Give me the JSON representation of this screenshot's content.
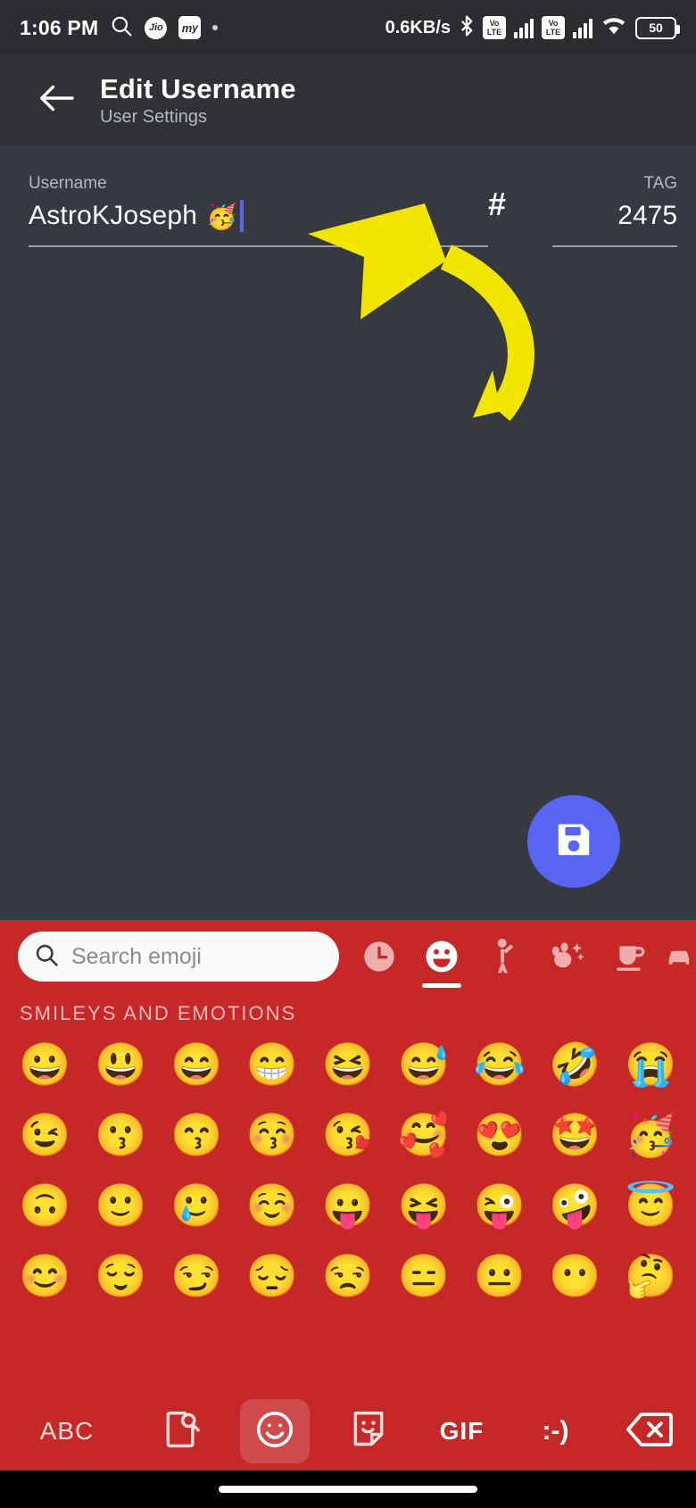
{
  "status_bar": {
    "time": "1:06 PM",
    "search_icon": "search-icon",
    "carrier_badges": [
      "Jio",
      "my"
    ],
    "dot_indicator": "•",
    "network_speed": "0.6KB/s",
    "bluetooth_icon": "bluetooth-icon",
    "volte_label_top": "Vo",
    "volte_label_bottom": "LTE",
    "sim_count": 2,
    "wifi_icon": "wifi-icon",
    "battery_percent": "50"
  },
  "app_bar": {
    "back_icon": "back-arrow-icon",
    "title": "Edit Username",
    "subtitle": "User Settings"
  },
  "form": {
    "username": {
      "label": "Username",
      "value": "AstroKJoseph",
      "emoji": "🥳",
      "caret_color": "#5865f2"
    },
    "separator": "#",
    "tag": {
      "label": "TAG",
      "value": "2475"
    }
  },
  "fab": {
    "name": "save-button",
    "icon": "floppy-disk-save-icon",
    "color": "#5865f2"
  },
  "annotations": {
    "arrow_color": "#f2e500",
    "arrow_top_name": "pointer-arrow-to-username-field",
    "arrow_bottom_name": "pointer-arrow-to-emoji-key"
  },
  "keyboard": {
    "background_color": "#c62828",
    "search": {
      "icon": "search-icon",
      "placeholder": "Search emoji",
      "value": ""
    },
    "category_tabs": [
      {
        "name": "tab-recent",
        "icon": "clock-icon",
        "glyph": "🕐",
        "active": false
      },
      {
        "name": "tab-smileys",
        "icon": "smiley-face-icon",
        "glyph": "😃",
        "active": true
      },
      {
        "name": "tab-people",
        "icon": "person-waving-icon",
        "glyph": "🧍",
        "active": false
      },
      {
        "name": "tab-nature",
        "icon": "animals-nature-icon",
        "glyph": "🐾",
        "active": false
      },
      {
        "name": "tab-food",
        "icon": "food-drink-icon",
        "glyph": "🍵",
        "active": false
      },
      {
        "name": "tab-travel",
        "icon": "travel-places-icon",
        "glyph": "🚗",
        "active": false
      }
    ],
    "section_title": "SMILEYS AND EMOTIONS",
    "emoji_rows": [
      [
        "😀",
        "😃",
        "😄",
        "😁",
        "😆",
        "😅",
        "😂",
        "🤣",
        "😭"
      ],
      [
        "😉",
        "😗",
        "😙",
        "😚",
        "😘",
        "🥰",
        "😍",
        "🤩",
        "🥳"
      ],
      [
        "🙃",
        "🙂",
        "🥲",
        "☺️",
        "😛",
        "😝",
        "😜",
        "🤪",
        "😇"
      ],
      [
        "😊",
        "😌",
        "😏",
        "😔",
        "😒",
        "😑",
        "😐",
        "😶",
        "🤔"
      ]
    ],
    "bottom_bar": [
      {
        "name": "abc-key",
        "label": "ABC",
        "icon": "abc-text",
        "active": false
      },
      {
        "name": "sticker-search-key",
        "label": "",
        "icon": "sticker-search-icon",
        "active": false
      },
      {
        "name": "emoji-key",
        "label": "",
        "icon": "smiley-outline-icon",
        "active": true
      },
      {
        "name": "sticker-key",
        "label": "",
        "icon": "sticker-icon",
        "active": false
      },
      {
        "name": "gif-key",
        "label": "GIF",
        "icon": "gif-text",
        "active": false
      },
      {
        "name": "emoticon-key",
        "label": ":-)",
        "icon": "emoticon-text",
        "active": false
      },
      {
        "name": "backspace-key",
        "label": "",
        "icon": "backspace-icon",
        "active": false
      }
    ]
  },
  "nav_bar": {
    "gesture_pill": "home-gesture-pill"
  }
}
